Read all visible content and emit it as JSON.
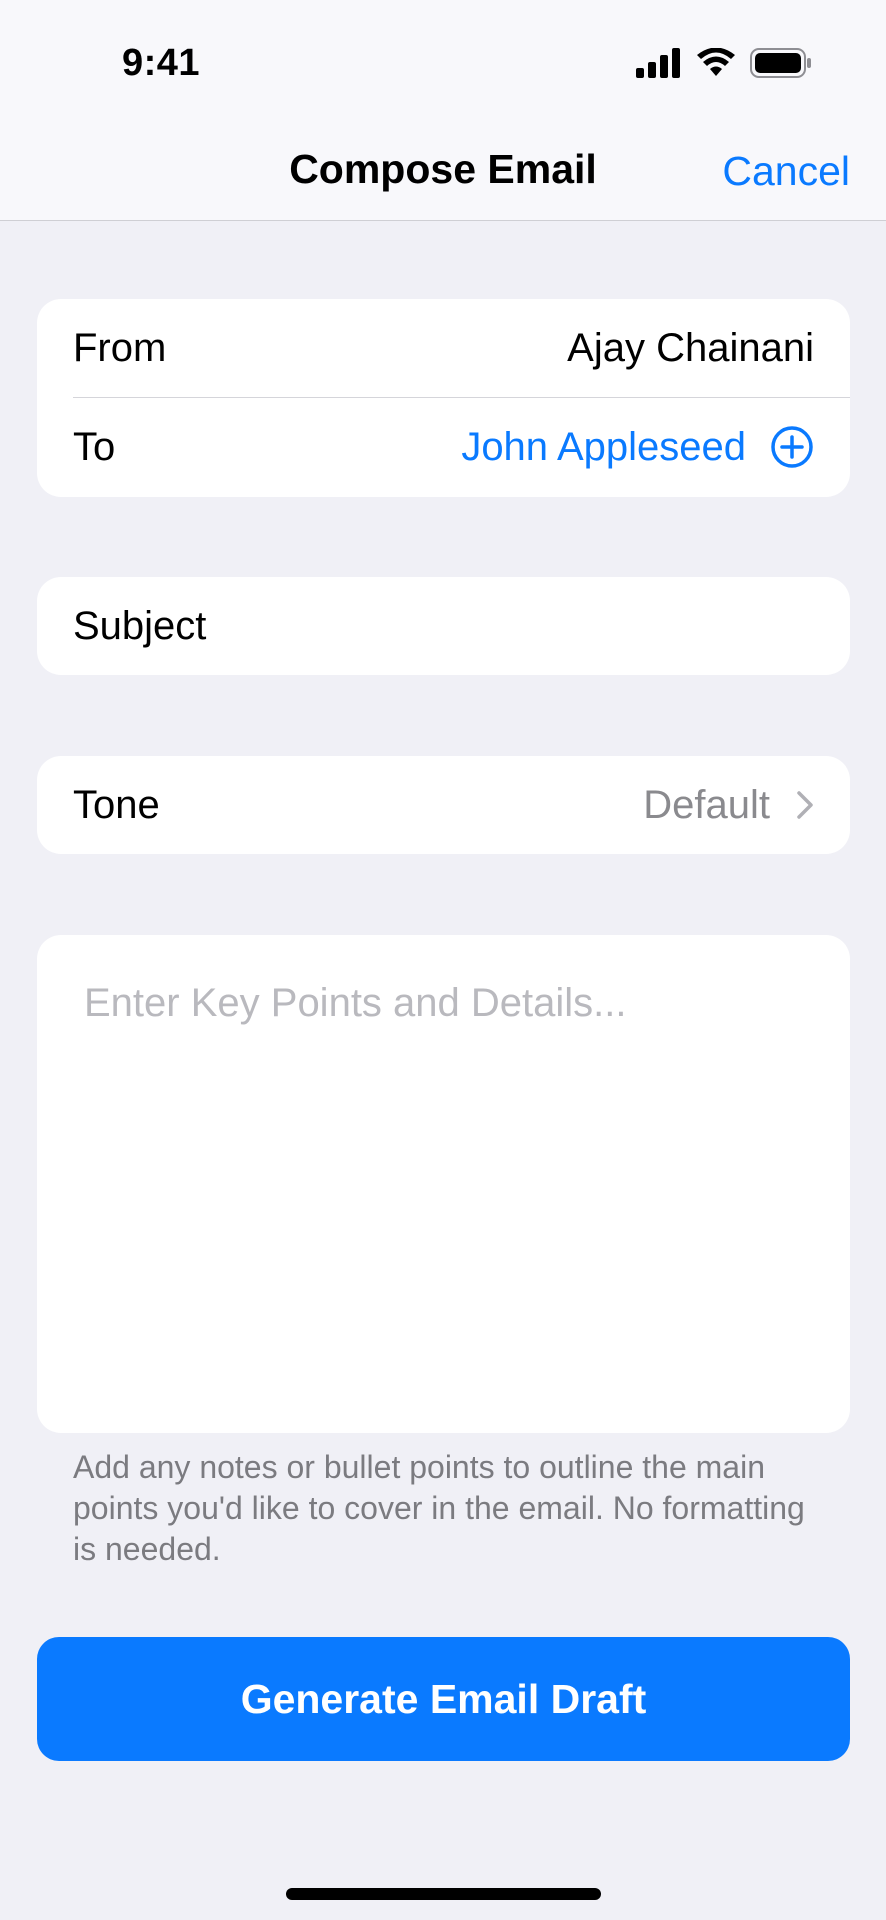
{
  "status_bar": {
    "time": "9:41"
  },
  "nav": {
    "title": "Compose Email",
    "cancel_label": "Cancel"
  },
  "header_card": {
    "from_label": "From",
    "from_value": "Ajay Chainani",
    "to_label": "To",
    "to_value": "John Appleseed"
  },
  "subject": {
    "label": "Subject"
  },
  "tone": {
    "label": "Tone",
    "value": "Default"
  },
  "notes": {
    "placeholder": "Enter Key Points and Details...",
    "footnote": "Add any notes or bullet points to outline the main points you'd like to cover in the email. No formatting is needed."
  },
  "primary_action": {
    "label": "Generate Email Draft"
  },
  "icons": {
    "signal": "cellular-signal-icon",
    "wifi": "wifi-icon",
    "battery": "battery-icon",
    "add": "plus-circle-icon",
    "chevron": "chevron-right-icon"
  },
  "colors": {
    "accent": "#0a7aff",
    "background": "#f0f0f6",
    "secondary_text": "#8a8a8e"
  }
}
